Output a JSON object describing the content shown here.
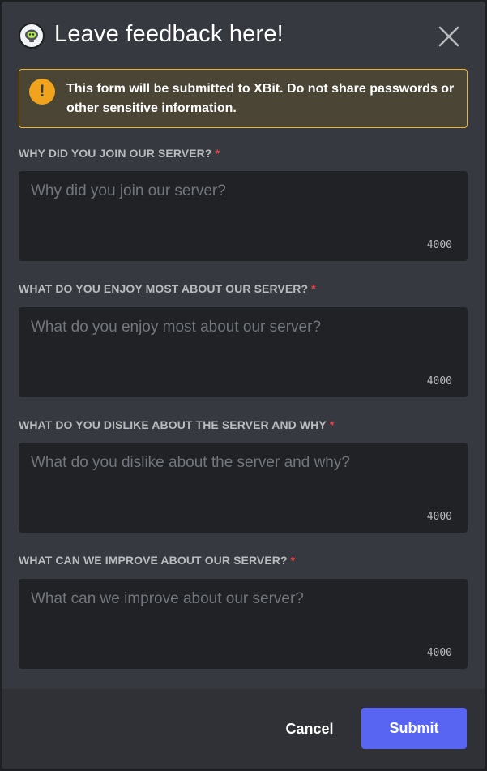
{
  "header": {
    "title": "Leave feedback here!",
    "app_icon": "bot-avatar-icon",
    "close_icon": "close-icon"
  },
  "warning": {
    "icon": "exclamation-icon",
    "prefix": "This form will be submitted to ",
    "app_name": "XBit",
    "suffix": ". Do not share passwords or other sensitive information.",
    "accent_color": "#f0b232"
  },
  "fields": [
    {
      "label": "WHY DID YOU JOIN OUR SERVER?",
      "required_mark": "*",
      "placeholder": "Why did you join our server?",
      "value": "",
      "counter": "4000"
    },
    {
      "label": "WHAT DO YOU ENJOY MOST ABOUT OUR SERVER?",
      "required_mark": "*",
      "placeholder": "What do you enjoy most about our server?",
      "value": "",
      "counter": "4000"
    },
    {
      "label": "WHAT DO YOU DISLIKE ABOUT THE SERVER AND WHY",
      "required_mark": "*",
      "placeholder": "What do you dislike about the server and why?",
      "value": "",
      "counter": "4000"
    },
    {
      "label": "WHAT CAN WE IMPROVE ABOUT OUR SERVER?",
      "required_mark": "*",
      "placeholder": "What can we improve about our server?",
      "value": "",
      "counter": "4000"
    }
  ],
  "footer": {
    "cancel_label": "Cancel",
    "submit_label": "Submit",
    "submit_color": "#5865f2"
  }
}
